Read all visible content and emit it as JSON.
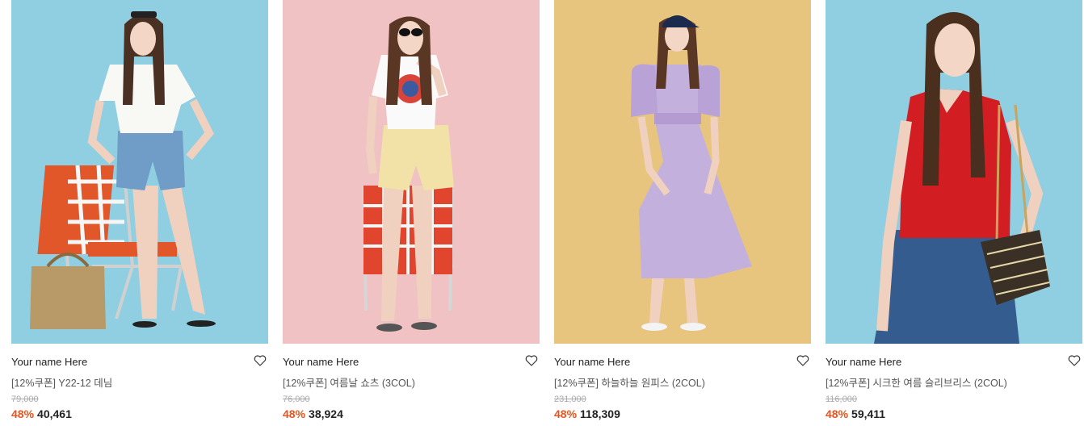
{
  "products": [
    {
      "brand": "Your name Here",
      "title": "[12%쿠폰] Y22-12 데님",
      "original_price": "79,000",
      "discount": "48%",
      "price": "40,461",
      "bg_color": "#8fcfe1"
    },
    {
      "brand": "Your name Here",
      "title": "[12%쿠폰] 여름날 쇼츠 (3COL)",
      "original_price": "76,000",
      "discount": "48%",
      "price": "38,924",
      "bg_color": "#f0c2c4"
    },
    {
      "brand": "Your name Here",
      "title": "[12%쿠폰] 하늘하늘 원피스 (2COL)",
      "original_price": "231,000",
      "discount": "48%",
      "price": "118,309",
      "bg_color": "#e8c57f"
    },
    {
      "brand": "Your name Here",
      "title": "[12%쿠폰] 시크한 여름 슬리브리스 (2COL)",
      "original_price": "116,000",
      "discount": "48%",
      "price": "59,411",
      "bg_color": "#8fcfe1"
    }
  ],
  "colors": {
    "discount": "#e8531e",
    "original_price": "#aaaaaa"
  },
  "icons": {
    "wishlist": "heart-outline-icon"
  }
}
